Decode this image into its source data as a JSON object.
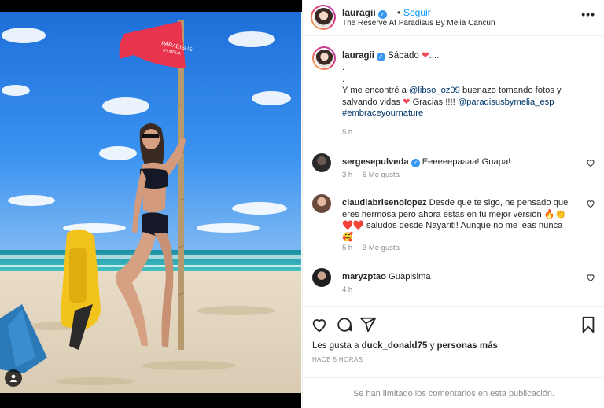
{
  "post": {
    "author": "lauragii",
    "follow_label": "Seguir",
    "separator": "•",
    "location": "The Reserve At Paradisus By Melia Cancun",
    "flag_text": "PARADISUS",
    "flag_subtext": "BY MELIA"
  },
  "caption": {
    "author": "lauragii",
    "first_line": "Sábado",
    "first_line_end": "....",
    "dot1": ".",
    "dot2": ".",
    "text_a": "Y me encontré a ",
    "mention1": "@libso_oz09",
    "text_b": " buenazo tomando fotos y salvando vidas ",
    "text_c": " Gracias !!!! ",
    "mention2": "@paradisusbymelia_esp",
    "hashtag": "#embraceyournature",
    "time": "5 h"
  },
  "comments": [
    {
      "user": "sergesepulveda",
      "verified": true,
      "text": "Eeeeeepaaaa! Guapa!",
      "time": "3 h",
      "likes": "6 Me gusta"
    },
    {
      "user": "claudiabrisenolopez",
      "verified": false,
      "text_a": "Desde que te sigo, he pensado que eres hermosa pero ahora estas en tu mejor versión ",
      "emoji1": "🔥👏",
      "text_b": " saludos desde Nayarit!! Aunque no me leas nunca ",
      "emoji2": "🥰",
      "hearts": "❤️❤️",
      "time": "5 h",
      "likes": "3 Me gusta"
    },
    {
      "user": "maryzptao",
      "verified": false,
      "text": "Guapisima",
      "time": "4 h"
    }
  ],
  "actions": {
    "likes_prefix": "Les gusta a ",
    "likes_user": "duck_donald75",
    "likes_mid": " y ",
    "likes_suffix": "personas más",
    "time_ago": "HACE 5 HORAS"
  },
  "footer": {
    "limited_text": "Se han limitado los comentarios en esta publicación."
  },
  "colors": {
    "accent_blue": "#0095f6",
    "verified_blue": "#3897f0",
    "heart_red": "#ed4956",
    "muted_gray": "#8e8e8e",
    "flag_red": "#e8344d",
    "float_yellow": "#f2c21d"
  },
  "icons": [
    "heart-icon",
    "comment-icon",
    "share-icon",
    "bookmark-icon",
    "more-icon",
    "verified-icon",
    "user-tag-icon"
  ]
}
